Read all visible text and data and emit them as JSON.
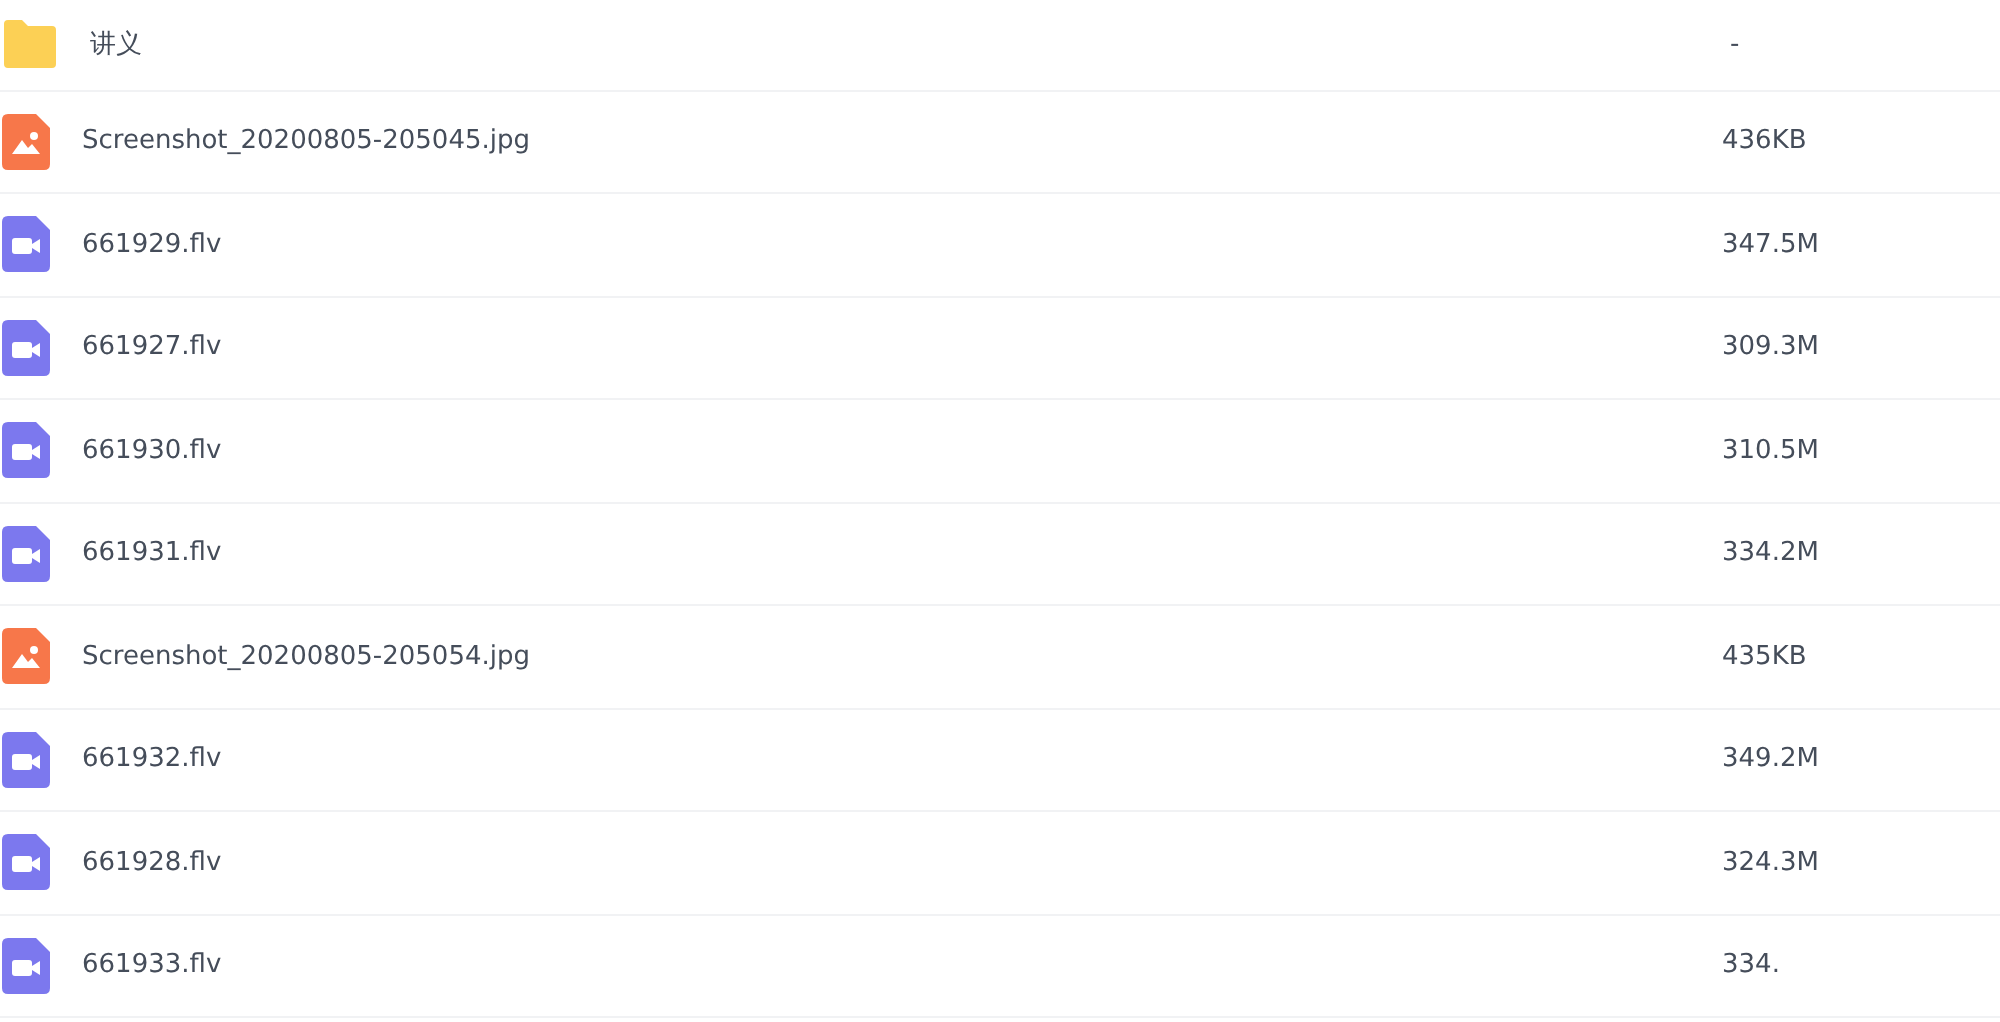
{
  "files": [
    {
      "kind": "folder",
      "name": "讲义",
      "size": "-"
    },
    {
      "kind": "image",
      "name": "Screenshot_20200805-205045.jpg",
      "size": "436KB"
    },
    {
      "kind": "video",
      "name": "661929.flv",
      "size": "347.5M"
    },
    {
      "kind": "video",
      "name": "661927.flv",
      "size": "309.3M"
    },
    {
      "kind": "video",
      "name": "661930.flv",
      "size": "310.5M"
    },
    {
      "kind": "video",
      "name": "661931.flv",
      "size": "334.2M"
    },
    {
      "kind": "image",
      "name": "Screenshot_20200805-205054.jpg",
      "size": "435KB"
    },
    {
      "kind": "video",
      "name": "661932.flv",
      "size": "349.2M"
    },
    {
      "kind": "video",
      "name": "661928.flv",
      "size": "324.3M"
    },
    {
      "kind": "video",
      "name": "661933.flv",
      "size": "334."
    }
  ]
}
